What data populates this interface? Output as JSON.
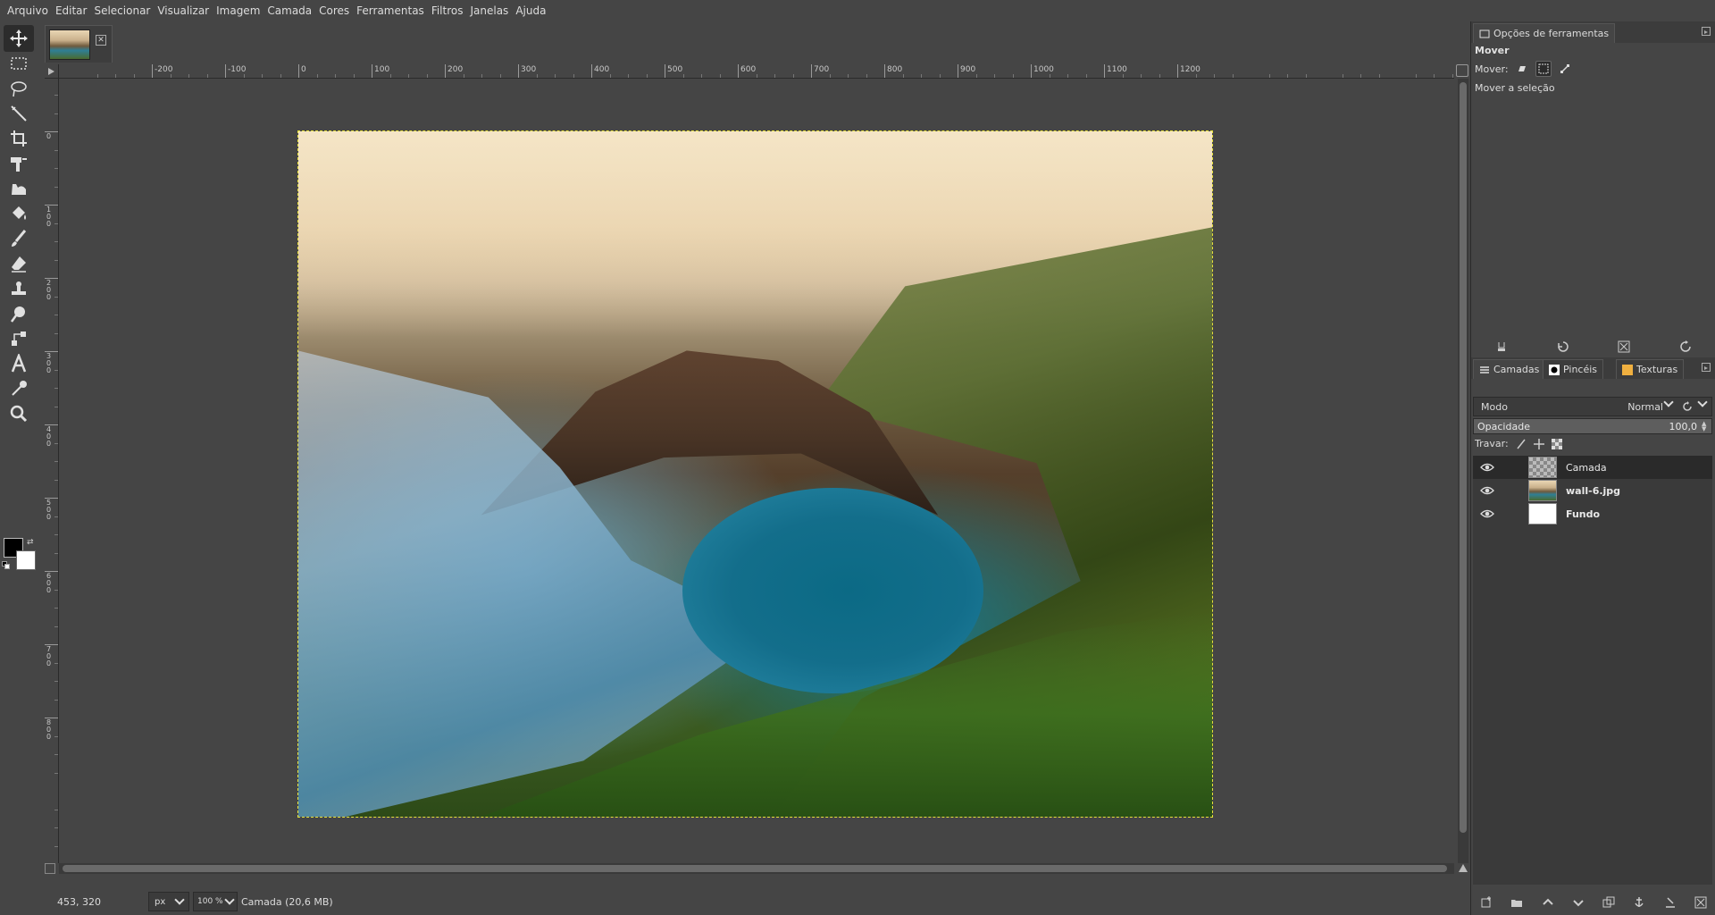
{
  "menu": [
    "Arquivo",
    "Editar",
    "Selecionar",
    "Visualizar",
    "Imagem",
    "Camada",
    "Cores",
    "Ferramentas",
    "Filtros",
    "Janelas",
    "Ajuda"
  ],
  "tools": [
    {
      "name": "move-tool-icon",
      "active": true
    },
    {
      "name": "rect-select-tool-icon"
    },
    {
      "name": "free-select-tool-icon"
    },
    {
      "name": "fuzzy-select-tool-icon"
    },
    {
      "name": "crop-tool-icon"
    },
    {
      "name": "unified-transform-tool-icon"
    },
    {
      "name": "warp-transform-tool-icon"
    },
    {
      "name": "bucket-fill-tool-icon"
    },
    {
      "name": "paintbrush-tool-icon"
    },
    {
      "name": "eraser-tool-icon"
    },
    {
      "name": "clone-tool-icon"
    },
    {
      "name": "smudge-tool-icon"
    },
    {
      "name": "paths-tool-icon"
    },
    {
      "name": "text-tool-icon"
    },
    {
      "name": "color-picker-tool-icon"
    },
    {
      "name": "zoom-tool-icon"
    }
  ],
  "colors": {
    "foreground": "#000000",
    "background": "#ffffff",
    "selection_outline": "#e8e23a"
  },
  "hruler_labels": [
    "-200",
    "-100",
    "0",
    "100",
    "200",
    "300",
    "400",
    "500",
    "600",
    "700",
    "800",
    "900",
    "1000",
    "1100",
    "1200"
  ],
  "vruler_labels": [
    "0",
    "100",
    "200",
    "300",
    "400",
    "500",
    "600",
    "700",
    "800"
  ],
  "status": {
    "coords": "453, 320",
    "unit": "px",
    "zoom": "100 %",
    "info": "Camada (20,6 MB)"
  },
  "tool_options": {
    "tab_label": "Opções de ferramentas",
    "title": "Mover",
    "move_label": "Mover:",
    "sub_label": "Mover a seleção"
  },
  "layers_panel": {
    "tabs": [
      "Camadas",
      "Pincéis",
      "Texturas"
    ],
    "mode_label": "Modo",
    "mode_value": "Normal",
    "opacity_label": "Opacidade",
    "opacity_value": "100,0",
    "lock_label": "Travar:",
    "layers": [
      {
        "name": "Camada",
        "thumb": "checker",
        "selected": true,
        "bold": false
      },
      {
        "name": "wall-6.jpg",
        "thumb": "photo",
        "selected": false,
        "bold": true
      },
      {
        "name": "Fundo",
        "thumb": "white",
        "selected": false,
        "bold": true
      }
    ]
  }
}
